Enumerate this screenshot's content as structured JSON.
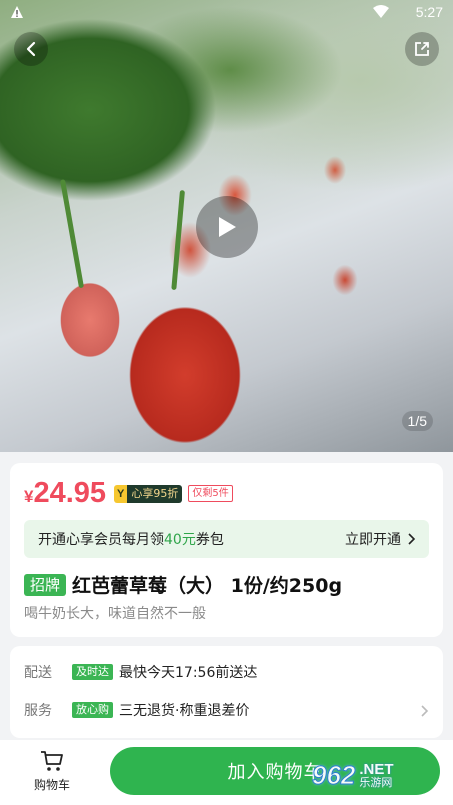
{
  "status_bar": {
    "time": "5:27"
  },
  "media": {
    "pager": "1/5"
  },
  "price": {
    "currency": "¥",
    "amount": "24.95",
    "vip_badge_letter": "Y",
    "vip_badge_text": "心享95折",
    "limit_text": "仅剩5件"
  },
  "member_bar": {
    "text_prefix": "开通心享会员每月领",
    "text_highlight": "40元",
    "text_suffix": "券包",
    "action": "立即开通"
  },
  "product": {
    "tag": "招牌",
    "title": "红芭蕾草莓（大） 1份/约250g",
    "subtitle": "喝牛奶长大，味道自然不一般"
  },
  "service": {
    "delivery_label": "配送",
    "delivery_tag": "及时达",
    "delivery_text": "最快今天17:56前送达",
    "service_label": "服务",
    "service_tag": "放心购",
    "service_text": "三无退货·称重退差价"
  },
  "bottom_bar": {
    "cart_label": "购物车",
    "add_to_cart": "加入购物车"
  },
  "watermark": {
    "num": "962",
    "domain": ".NET",
    "sub": "乐游网"
  }
}
